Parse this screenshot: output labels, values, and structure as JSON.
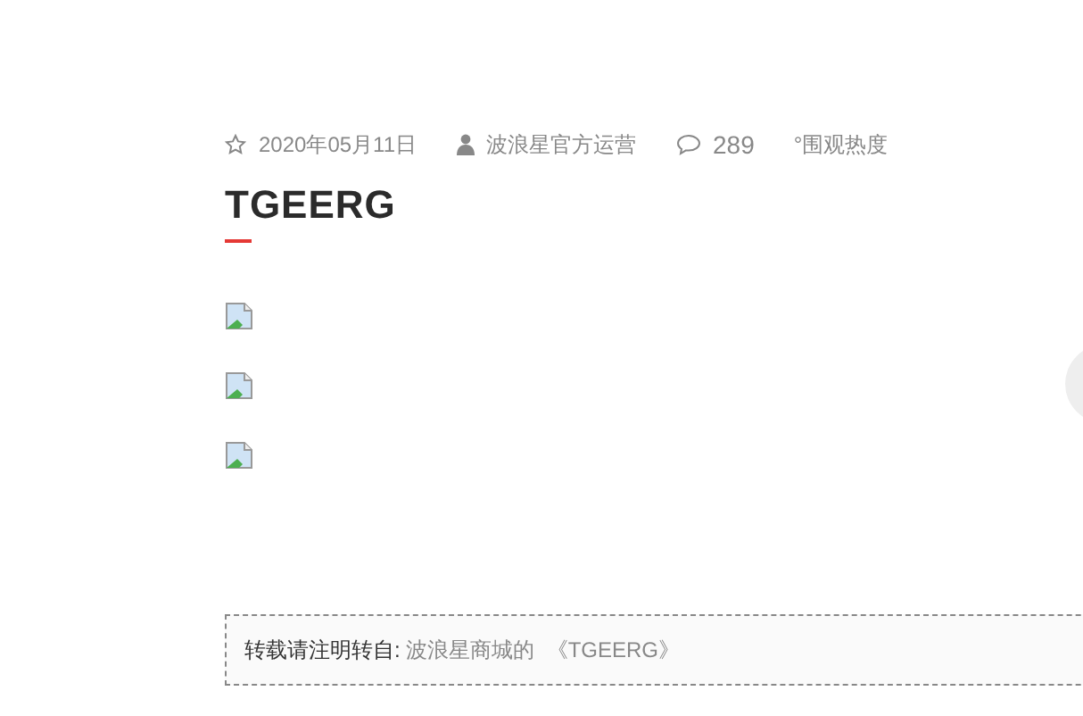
{
  "meta": {
    "date": "2020年05月11日",
    "author": "波浪星官方运营",
    "comments": "289",
    "views_label": "°围观热度"
  },
  "title": "TGEERG",
  "images": [
    {
      "kind": "broken-image"
    },
    {
      "kind": "broken-image"
    },
    {
      "kind": "broken-image"
    }
  ],
  "notice": {
    "label": "转载请注明转自:",
    "source": "波浪星商城的",
    "link": "《TGEERG》"
  }
}
